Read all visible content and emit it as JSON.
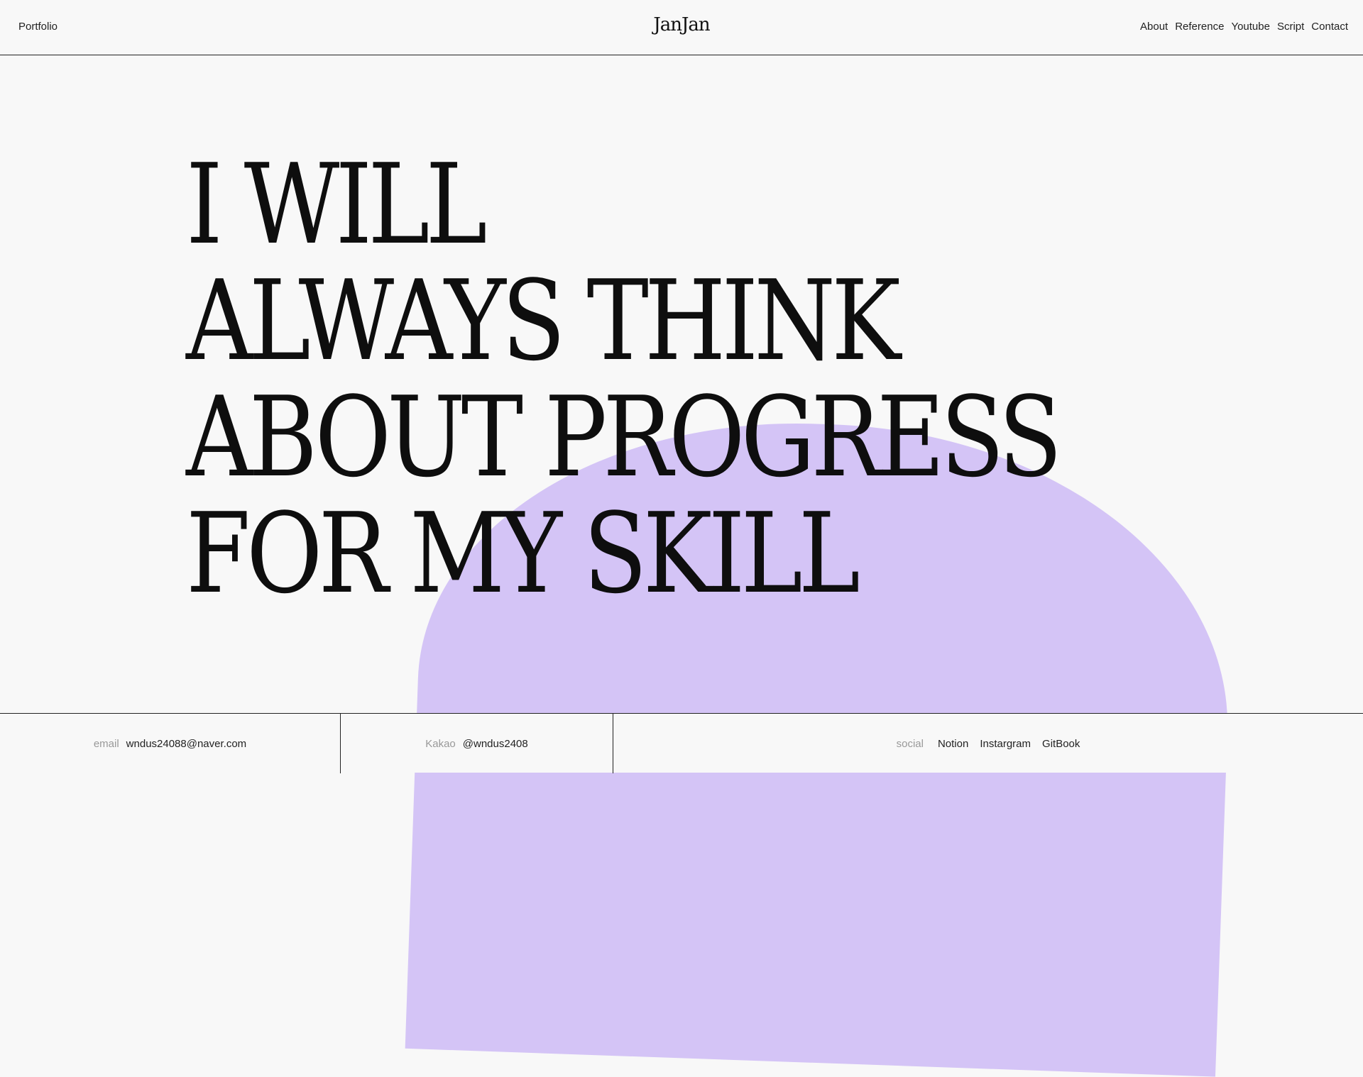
{
  "header": {
    "left_link": "Portfolio",
    "logo": "JanJan",
    "nav": [
      "About",
      "Reference",
      "Youtube",
      "Script",
      "Contact"
    ]
  },
  "hero": {
    "lines": [
      "I WILL",
      "ALWAYS THINK",
      "ABOUT PROGRESS",
      "FOR MY SKILL"
    ]
  },
  "footer": {
    "email": {
      "label": "email",
      "value": "wndus24088@naver.com"
    },
    "kakao": {
      "label": "Kakao",
      "value": "@wndus2408"
    },
    "social": {
      "label": "social",
      "links": [
        "Notion",
        "Instargram",
        "GitBook"
      ]
    }
  },
  "colors": {
    "background": "#f8f8f8",
    "accent_blob": "#d4c4f6",
    "text": "#111111",
    "muted": "#999999"
  }
}
